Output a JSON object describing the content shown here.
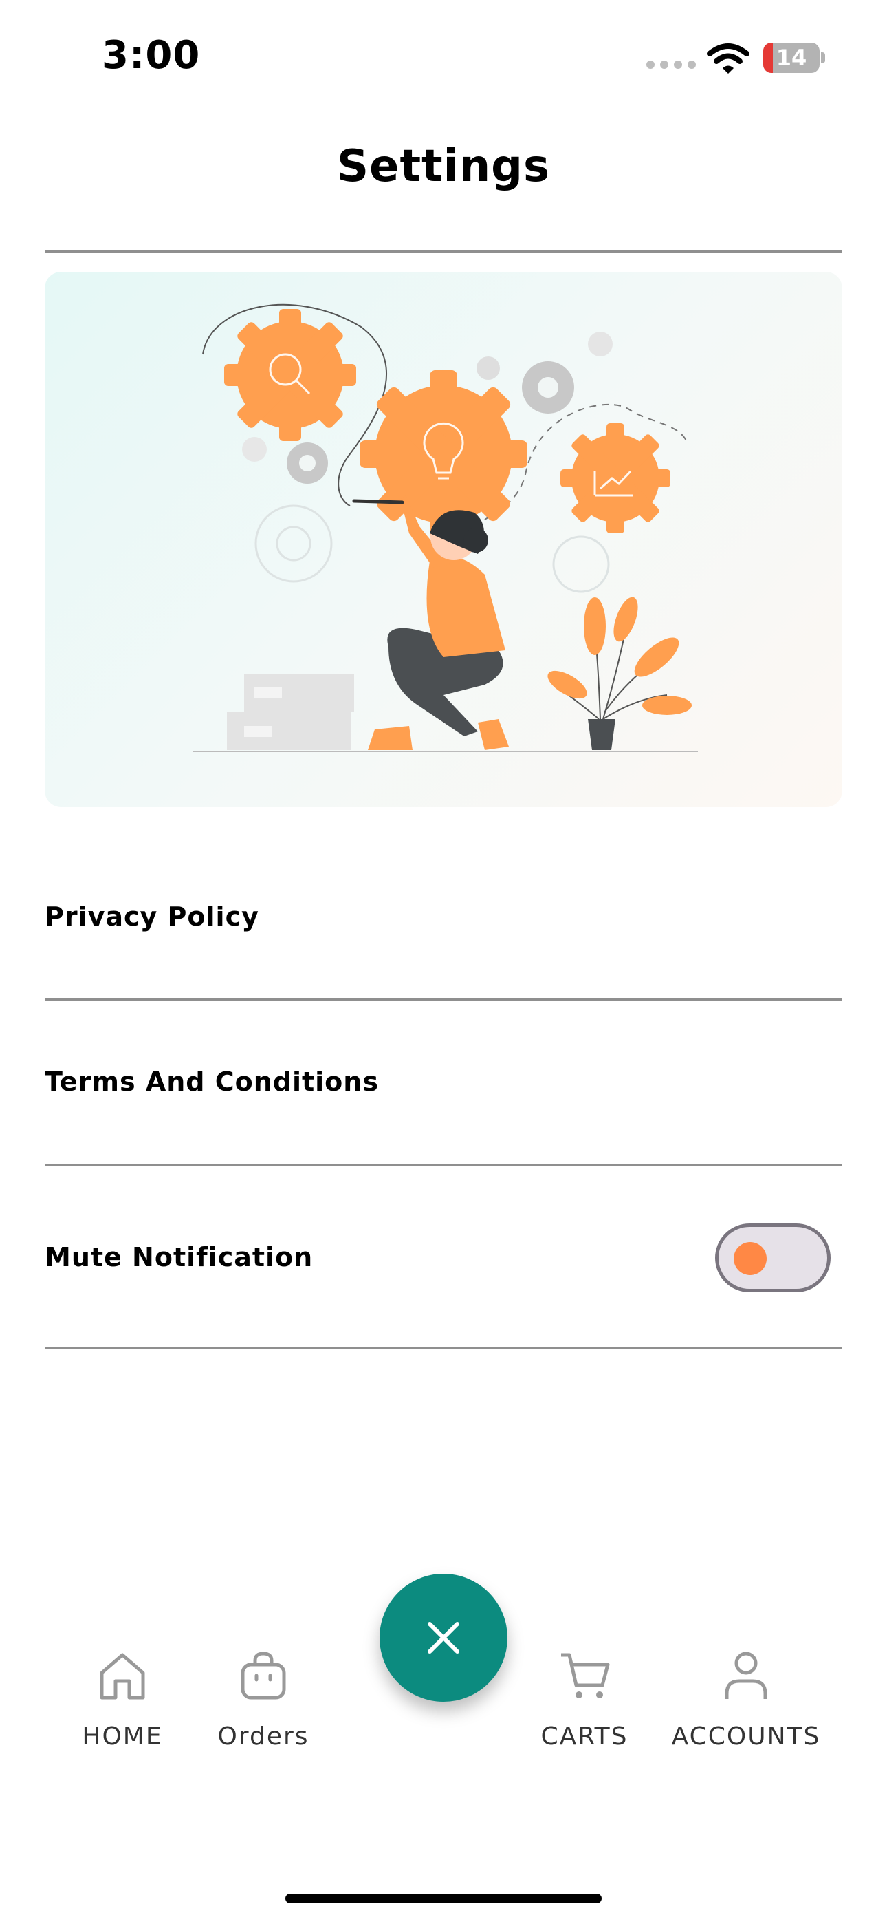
{
  "status_bar": {
    "time": "3:00",
    "battery": "14"
  },
  "header": {
    "title": "Settings"
  },
  "settings": {
    "items": [
      {
        "label": "Privacy Policy"
      },
      {
        "label": "Terms And Conditions"
      },
      {
        "label": "Mute Notification"
      }
    ],
    "mute_toggle": {
      "on": false
    }
  },
  "fab": {
    "icon": "close-icon"
  },
  "bottom_nav": {
    "items": [
      {
        "label": "HOME",
        "icon": "home-icon"
      },
      {
        "label": "Orders",
        "icon": "bag-icon"
      },
      {
        "label": "CARTS",
        "icon": "cart-icon"
      },
      {
        "label": "ACCOUNTS",
        "icon": "user-icon"
      }
    ]
  },
  "colors": {
    "accent": "#0c8b7f",
    "illustration_orange": "#ff9f4f",
    "toggle_knob": "#ff8845"
  }
}
